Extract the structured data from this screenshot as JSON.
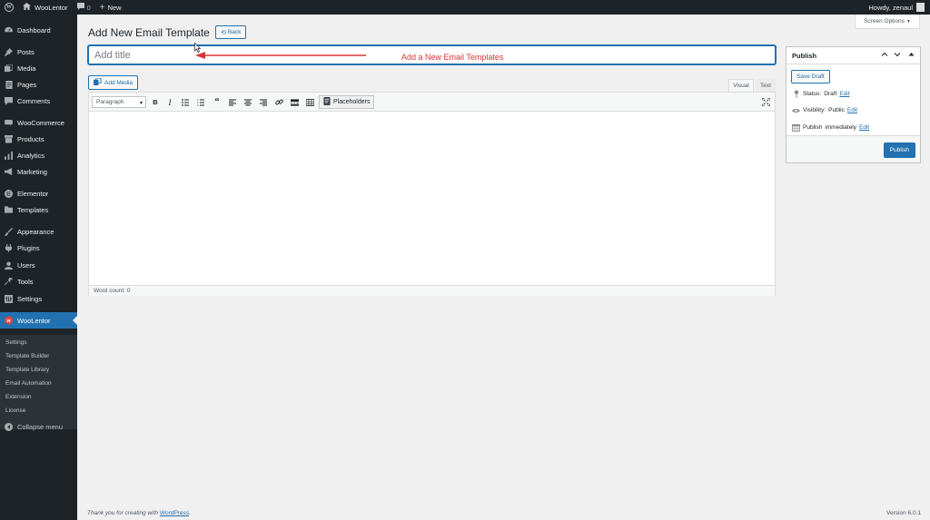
{
  "admin_bar": {
    "site_name": "WooLentor",
    "comments_count": "0",
    "new_label": "New",
    "howdy": "Howdy, zenaul"
  },
  "sidebar": {
    "items": [
      {
        "label": "Dashboard",
        "icon": "dashboard-icon"
      },
      {
        "label": "Posts",
        "icon": "pin-icon"
      },
      {
        "label": "Media",
        "icon": "media-icon"
      },
      {
        "label": "Pages",
        "icon": "page-icon"
      },
      {
        "label": "Comments",
        "icon": "comment-icon"
      },
      {
        "label": "WooCommerce",
        "icon": "woo-icon"
      },
      {
        "label": "Products",
        "icon": "archive-icon"
      },
      {
        "label": "Analytics",
        "icon": "bar-chart-icon"
      },
      {
        "label": "Marketing",
        "icon": "megaphone-icon"
      },
      {
        "label": "Elementor",
        "icon": "elementor-icon"
      },
      {
        "label": "Templates",
        "icon": "folder-icon"
      },
      {
        "label": "Appearance",
        "icon": "paintbrush-icon"
      },
      {
        "label": "Plugins",
        "icon": "plug-icon"
      },
      {
        "label": "Users",
        "icon": "users-icon"
      },
      {
        "label": "Tools",
        "icon": "wrench-icon"
      },
      {
        "label": "Settings",
        "icon": "settings-icon"
      },
      {
        "label": "WooLentor",
        "icon": "woolentor-icon"
      }
    ],
    "submenu": [
      "Settings",
      "Template Builder",
      "Template Library",
      "Email Automation",
      "Extension",
      "License"
    ],
    "collapse_label": "Collapse menu"
  },
  "screen_options": "Screen Options",
  "page": {
    "title": "Add New Email Template",
    "back_label": "Back",
    "title_placeholder": "Add title",
    "annotation": "Add a New Email Templates"
  },
  "editor": {
    "add_media_label": "Add Media",
    "tab_visual": "Visual",
    "tab_text": "Text",
    "format_value": "Paragraph",
    "placeholders_label": "Placeholders",
    "word_count": "Word count: 0",
    "toolbar_icons": [
      "bold-icon",
      "italic-icon",
      "bullet-list-icon",
      "numbered-list-icon",
      "blockquote-icon",
      "align-left-icon",
      "align-center-icon",
      "align-right-icon",
      "link-icon",
      "read-more-icon",
      "toolbar-toggle-icon"
    ]
  },
  "publish": {
    "title": "Publish",
    "save_draft": "Save Draft",
    "status_label": "Status:",
    "status_value": "Draft",
    "visibility_label": "Visibility:",
    "visibility_value": "Public",
    "publish_label": "Publish",
    "publish_value": "immediately",
    "edit": "Edit",
    "publish_button": "Publish"
  },
  "footer": {
    "thanks_prefix": "Thank you for creating with",
    "thanks_link": "WordPress",
    "thanks_suffix": ".",
    "version": "Version 6.0.1"
  },
  "colors": {
    "admin_dark": "#1d2327",
    "accent": "#2271b1",
    "annotation_red": "#d63638"
  }
}
